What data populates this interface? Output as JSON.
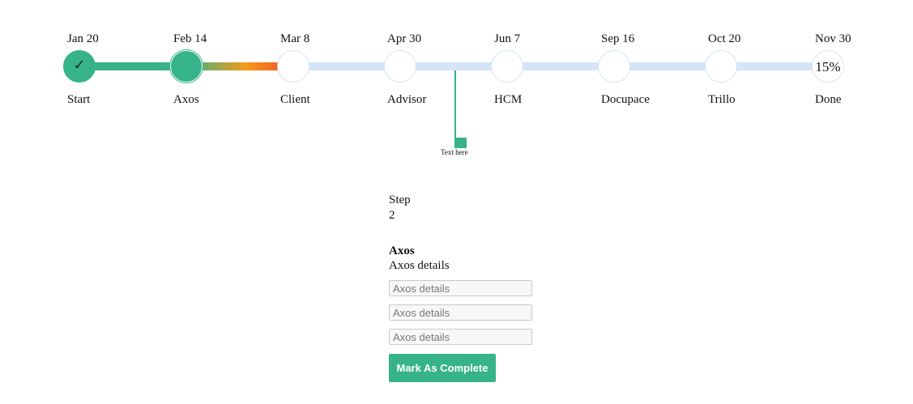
{
  "timeline": {
    "steps": [
      {
        "date": "Jan 20",
        "label": "Start",
        "status": "complete",
        "symbol": "✓",
        "icon": "check-icon"
      },
      {
        "date": "Feb 14",
        "label": "Axos",
        "status": "active",
        "symbol": ""
      },
      {
        "date": "Mar 8",
        "label": "Client",
        "status": "pending",
        "symbol": ""
      },
      {
        "date": "Apr 30",
        "label": "Advisor",
        "status": "pending",
        "symbol": ""
      },
      {
        "date": "Jun 7",
        "label": "HCM",
        "status": "pending",
        "symbol": ""
      },
      {
        "date": "Sep 16",
        "label": "Docupace",
        "status": "pending",
        "symbol": ""
      },
      {
        "date": "Oct 20",
        "label": "Trillo",
        "status": "pending",
        "symbol": ""
      },
      {
        "date": "Nov 30",
        "label": "Done",
        "status": "pending",
        "symbol": "15%"
      }
    ],
    "progress_percent": 15,
    "marker_text": "Text here"
  },
  "panel": {
    "step_label": "Step",
    "step_number": "2",
    "title": "Axos",
    "subtitle": "Axos details",
    "fields": [
      {
        "placeholder": "Axos details",
        "value": ""
      },
      {
        "placeholder": "Axos details",
        "value": ""
      },
      {
        "placeholder": "Axos details",
        "value": ""
      }
    ],
    "button_label": "Mark As Complete"
  },
  "colors": {
    "accent_green": "#36b389",
    "pending_track": "#d6e4f7",
    "transition_orange": "#f39a1b",
    "transition_red": "#f24a22"
  }
}
